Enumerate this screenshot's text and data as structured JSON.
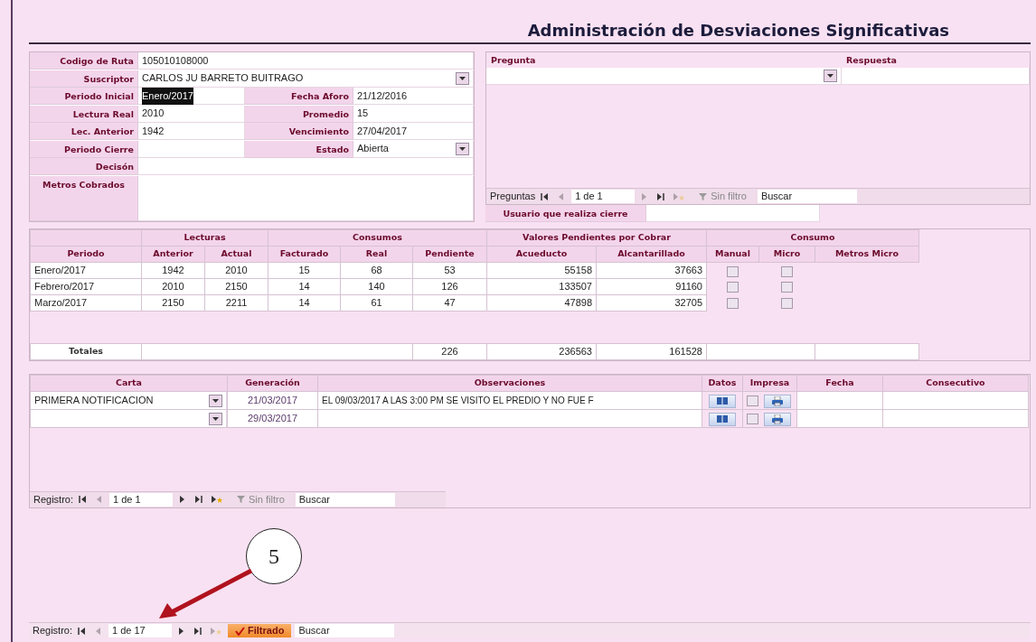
{
  "title": "Administración de Desviaciones Significativas",
  "form": {
    "rows": [
      {
        "fields": [
          {
            "label": "Codigo de Ruta",
            "value": "105010108000"
          }
        ]
      },
      {
        "fields": [
          {
            "label": "Suscriptor",
            "value": "CARLOS JU BARRETO BUITRAGO",
            "kind": "select"
          }
        ]
      },
      {
        "fields": [
          {
            "label": "Periodo Inicial",
            "value": "Enero/2017",
            "highlighted": true
          },
          {
            "label": "Fecha Aforo",
            "value": "21/12/2016"
          }
        ]
      },
      {
        "fields": [
          {
            "label": "Lectura Real",
            "value": "2010"
          },
          {
            "label": "Promedio",
            "value": "15"
          }
        ]
      },
      {
        "fields": [
          {
            "label": "Lec. Anterior",
            "value": "1942"
          },
          {
            "label": "Vencimiento",
            "value": "27/04/2017"
          }
        ]
      },
      {
        "fields": [
          {
            "label": "Periodo Cierre"
          },
          {
            "label": "Estado",
            "value": "Abierta",
            "kind": "select"
          }
        ]
      },
      {
        "fields": [
          {
            "label": "Decisón"
          }
        ]
      },
      {
        "fields": [
          {
            "label": "Metros Cobrados",
            "kind": "area"
          }
        ]
      }
    ]
  },
  "questions": {
    "columns": [
      "Pregunta",
      "Respuesta"
    ],
    "navigator": {
      "label": "Preguntas",
      "position": "1 de 1",
      "buttons": [
        {
          "kind": "first",
          "disabled": false
        },
        {
          "kind": "prev",
          "disabled": true
        },
        {
          "kind": "next",
          "disabled": true
        },
        {
          "kind": "last",
          "disabled": false
        },
        {
          "kind": "new",
          "disabled": true
        }
      ],
      "filter": {
        "label": "Sin filtro",
        "filtered": false
      },
      "search": {
        "placeholder": "Buscar"
      }
    },
    "closing_user": {
      "label": "Usuario que realiza cierre"
    }
  },
  "readings": {
    "groups": [
      {
        "columns": [
          "Periodo"
        ]
      },
      {
        "label": "Lecturas",
        "columns": [
          "Anterior",
          "Actual"
        ]
      },
      {
        "label": "Consumos",
        "columns": [
          "Facturado",
          "Real",
          "Pendiente"
        ]
      },
      {
        "label": "Valores Pendientes por Cobrar",
        "columns": [
          "Acueducto",
          "Alcantarillado"
        ]
      },
      {
        "label": "Consumo",
        "columns": [
          "Manual",
          "Micro",
          "Metros Micro"
        ]
      }
    ],
    "rows": [
      {
        "periodo": "Enero/2017",
        "anterior": "1942",
        "actual": "2010",
        "facturado": "15",
        "real": "68",
        "pendiente": "53",
        "acueducto": "55158",
        "alcantarillado": "37663",
        "manual": false,
        "micro": false
      },
      {
        "periodo": "Febrero/2017",
        "anterior": "2010",
        "actual": "2150",
        "facturado": "14",
        "real": "140",
        "pendiente": "126",
        "acueducto": "133507",
        "alcantarillado": "91160",
        "manual": false,
        "micro": false
      },
      {
        "periodo": "Marzo/2017",
        "anterior": "2150",
        "actual": "2211",
        "facturado": "14",
        "real": "61",
        "pendiente": "47",
        "acueducto": "47898",
        "alcantarillado": "32705",
        "manual": false,
        "micro": false
      }
    ],
    "totals": {
      "label": "Totales",
      "pendiente": "226",
      "acueducto": "236563",
      "alcantarillado": "161528"
    }
  },
  "letters": {
    "columns": [
      "Carta",
      "Generación",
      "Observaciones",
      "Datos",
      "Impresa",
      "Fecha",
      "Consecutivo"
    ],
    "rows": [
      {
        "carta": "PRIMERA NOTIFICACION",
        "generacion": "21/03/2017",
        "observaciones": "EL 09/03/2017 A LAS 3:00 PM SE VISITO EL PREDIO Y NO FUE F",
        "impresa": false
      },
      {
        "generacion": "29/03/2017",
        "impresa": false
      }
    ],
    "navigator": {
      "label": "Registro:",
      "position": "1 de 1",
      "buttons": [
        {
          "kind": "first",
          "disabled": false
        },
        {
          "kind": "prev",
          "disabled": true
        },
        {
          "kind": "next",
          "disabled": false
        },
        {
          "kind": "last",
          "disabled": false
        },
        {
          "kind": "new",
          "disabled": false
        }
      ],
      "filter": {
        "label": "Sin filtro",
        "filtered": false
      },
      "search": {
        "placeholder": "Buscar"
      }
    }
  },
  "annotation": {
    "label": "5"
  },
  "navigator": {
    "label": "Registro:",
    "position": "1 de 17",
    "buttons": [
      {
        "kind": "first",
        "disabled": false
      },
      {
        "kind": "prev",
        "disabled": true
      },
      {
        "kind": "next",
        "disabled": false
      },
      {
        "kind": "last",
        "disabled": false
      },
      {
        "kind": "new",
        "disabled": true
      }
    ],
    "filter": {
      "label": "Filtrado",
      "filtered": true
    },
    "search": {
      "placeholder": "Buscar"
    }
  }
}
